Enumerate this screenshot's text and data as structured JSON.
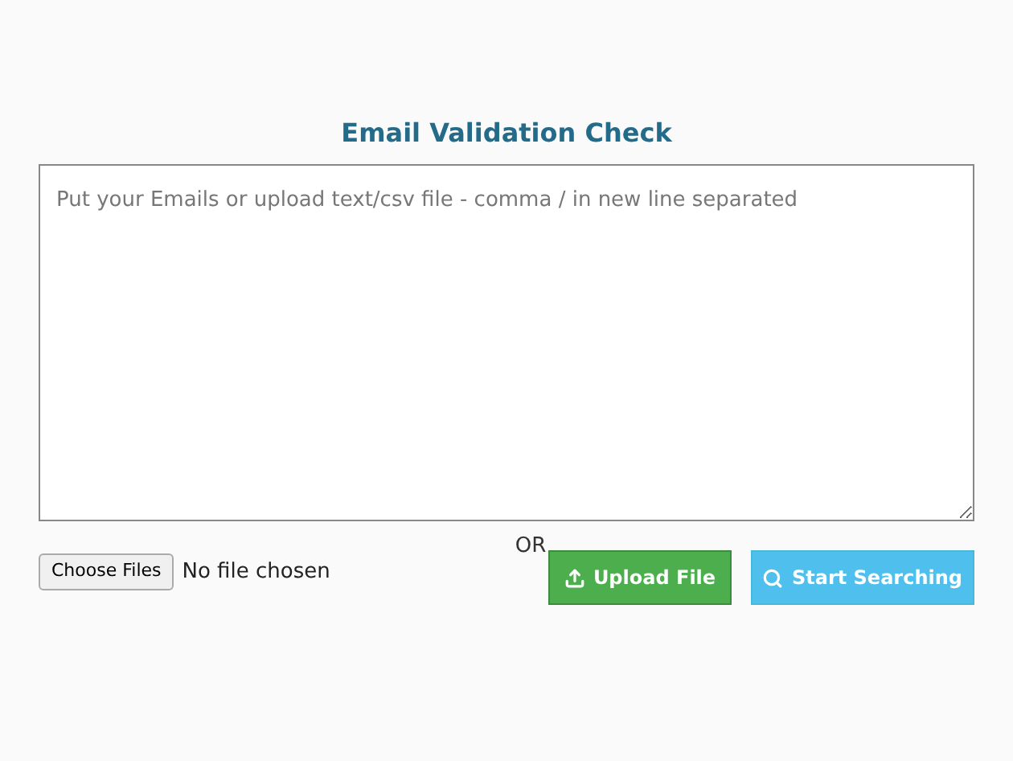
{
  "title": "Email Validation Check",
  "email_input": {
    "placeholder": "Put your Emails or upload text/csv file - comma / in new line separated"
  },
  "separator": "OR",
  "file_picker": {
    "button": "Choose Files",
    "status": "No file chosen"
  },
  "buttons": [
    {
      "kind": "upload",
      "label": "Upload File"
    },
    {
      "kind": "search",
      "label": "Start Searching"
    }
  ]
}
